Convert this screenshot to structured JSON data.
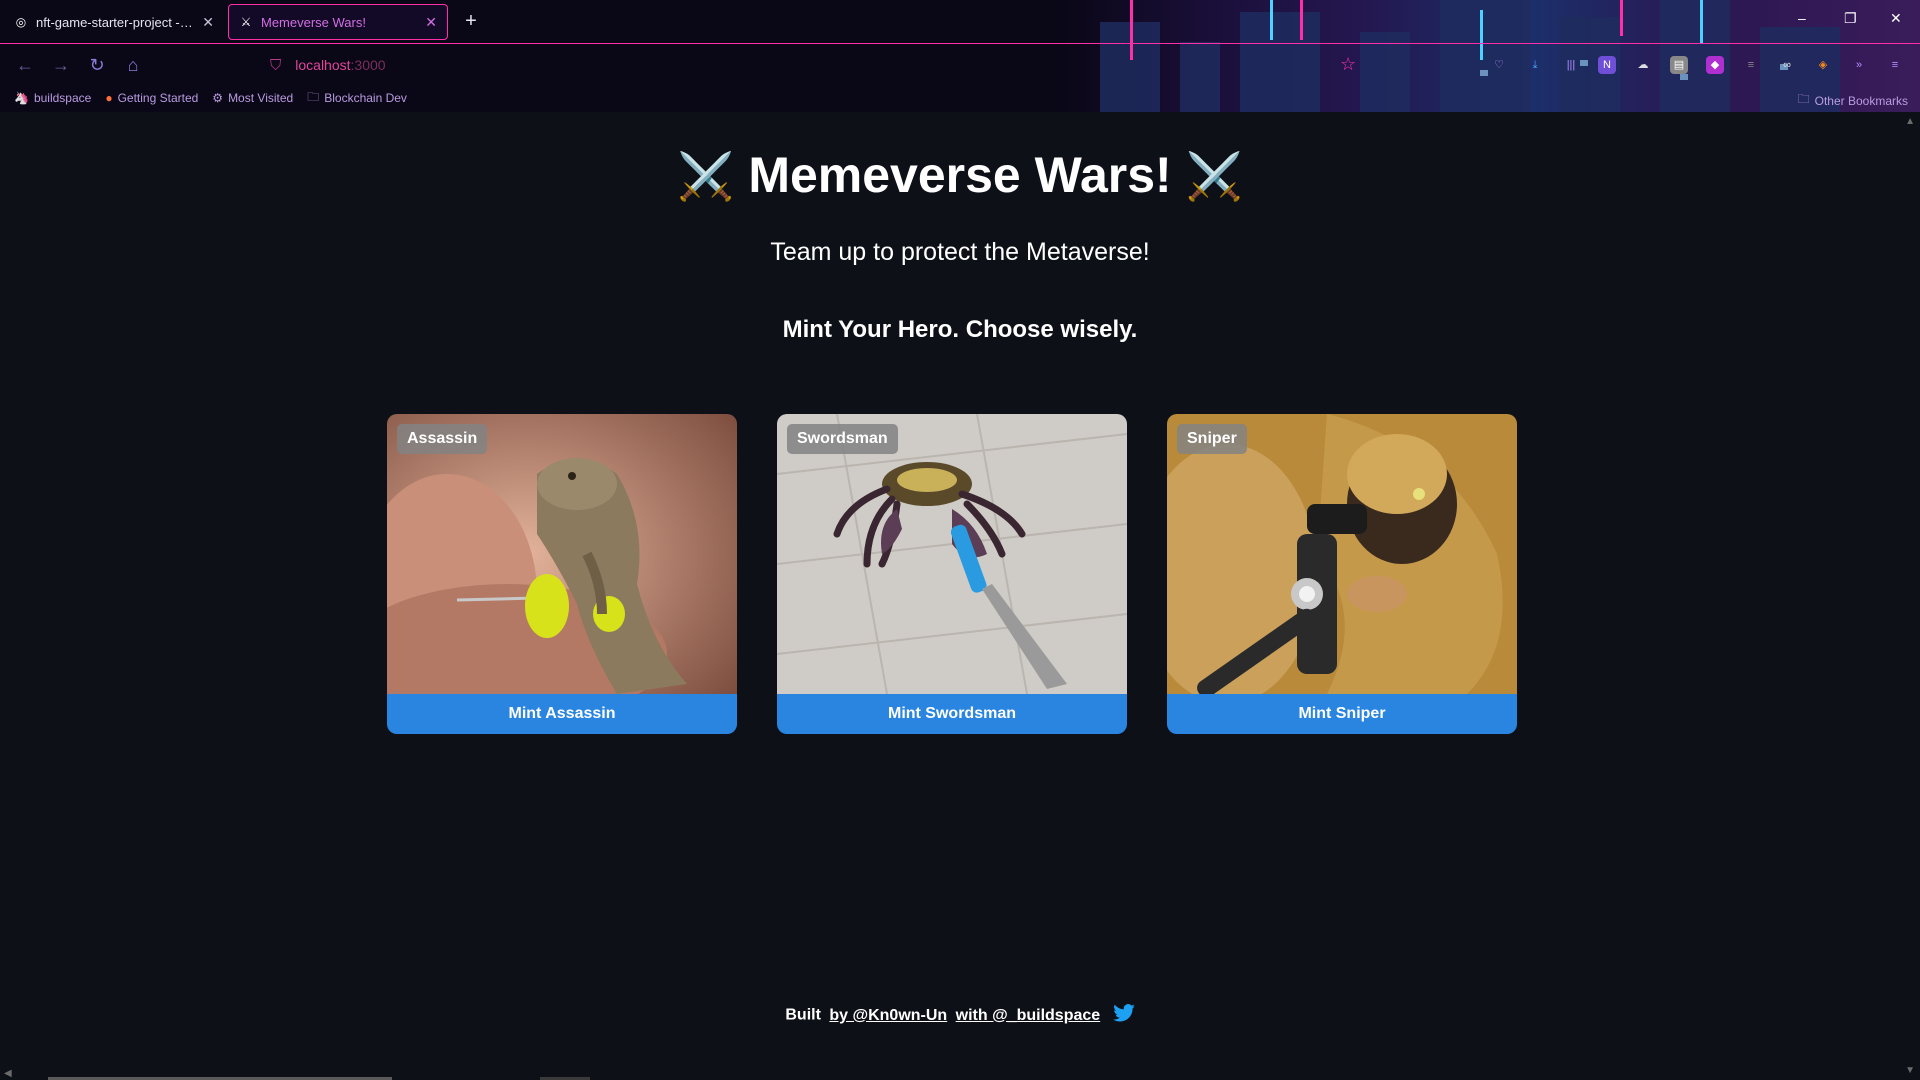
{
  "browser": {
    "tabs": [
      {
        "title": "nft-game-starter-project - Repli",
        "favicon": "replit-icon"
      },
      {
        "title": "Memeverse Wars!",
        "favicon": "crossed-swords-icon"
      }
    ],
    "new_tab_label": "+",
    "url_host": "localhost",
    "url_port": ":3000",
    "bookmarks": [
      {
        "label": "buildspace",
        "icon": "unicorn-icon"
      },
      {
        "label": "Getting Started",
        "icon": "firefox-icon"
      },
      {
        "label": "Most Visited",
        "icon": "gear-icon"
      },
      {
        "label": "Blockchain Dev",
        "icon": "folder-icon"
      }
    ],
    "other_bookmarks": "Other Bookmarks",
    "accent": "#ff2fa8"
  },
  "page": {
    "title": "Memeverse Wars!",
    "title_emoji": "⚔️",
    "subtitle": "Team up to protect the Metaverse!",
    "prompt": "Mint Your Hero. Choose wisely.",
    "characters": [
      {
        "name": "Assassin",
        "button": "Mint Assassin"
      },
      {
        "name": "Swordsman",
        "button": "Mint Swordsman"
      },
      {
        "name": "Sniper",
        "button": "Mint Sniper"
      }
    ],
    "footer": {
      "built": "Built",
      "by_link": "by @Kn0wn-Un",
      "with_link": "with @_buildspace"
    },
    "button_color": "#2a85e0"
  }
}
